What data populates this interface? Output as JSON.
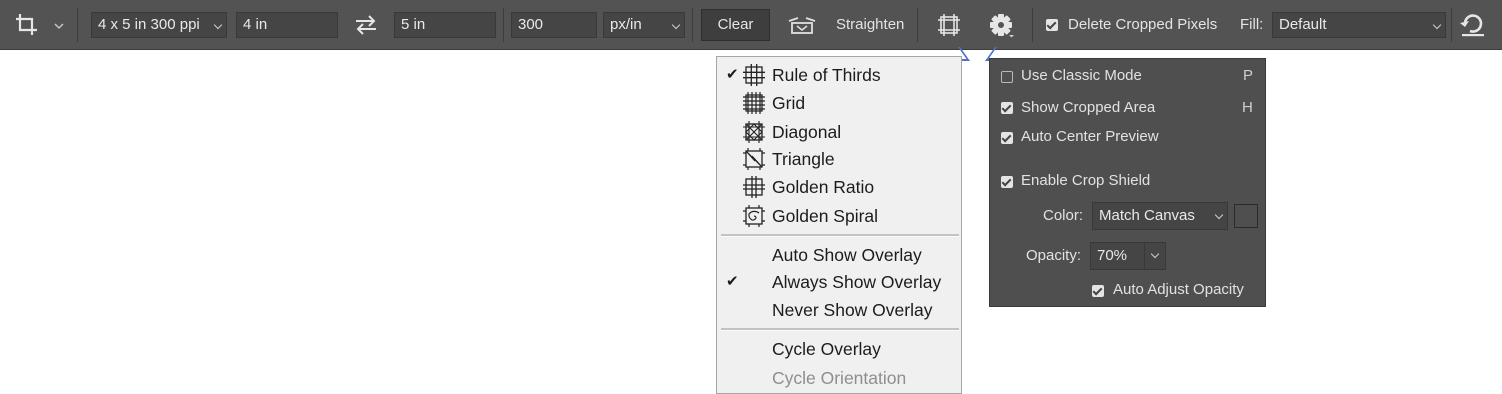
{
  "toolbar": {
    "preset": "4 x 5 in 300 ppi",
    "width": "4 in",
    "height": "5 in",
    "resolution": "300",
    "resolution_unit": "px/in",
    "clear": "Clear",
    "straighten": "Straighten",
    "delete_cropped": "Delete Cropped Pixels",
    "fill_label": "Fill:",
    "fill_value": "Default"
  },
  "overlay_menu": {
    "overlays": [
      {
        "label": "Rule of Thirds",
        "checked": true,
        "icon": "rule-of-thirds-icon"
      },
      {
        "label": "Grid",
        "checked": false,
        "icon": "grid-icon"
      },
      {
        "label": "Diagonal",
        "checked": false,
        "icon": "diagonal-icon"
      },
      {
        "label": "Triangle",
        "checked": false,
        "icon": "triangle-icon"
      },
      {
        "label": "Golden Ratio",
        "checked": false,
        "icon": "golden-ratio-icon"
      },
      {
        "label": "Golden Spiral",
        "checked": false,
        "icon": "golden-spiral-icon"
      }
    ],
    "modes": [
      {
        "label": "Auto Show Overlay",
        "checked": false
      },
      {
        "label": "Always Show Overlay",
        "checked": true
      },
      {
        "label": "Never Show Overlay",
        "checked": false
      }
    ],
    "cycle_overlay": "Cycle Overlay",
    "cycle_orientation": "Cycle Orientation",
    "check_mark": "✔"
  },
  "settings": {
    "classic_mode": {
      "label": "Use Classic Mode",
      "key": "P",
      "checked": false
    },
    "show_cropped": {
      "label": "Show Cropped Area",
      "key": "H",
      "checked": true
    },
    "auto_center": {
      "label": "Auto Center Preview",
      "checked": true
    },
    "crop_shield": {
      "label": "Enable Crop Shield",
      "checked": true
    },
    "color_label": "Color:",
    "color_value": "Match Canvas",
    "opacity_label": "Opacity:",
    "opacity_value": "70%",
    "auto_adjust": {
      "label": "Auto Adjust Opacity",
      "checked": true
    }
  },
  "colors": {
    "toolbar_bg": "#535353",
    "panel_bg": "#4f4f4f",
    "menu_bg": "#f0f0f0",
    "accent": "#4e71c9"
  }
}
